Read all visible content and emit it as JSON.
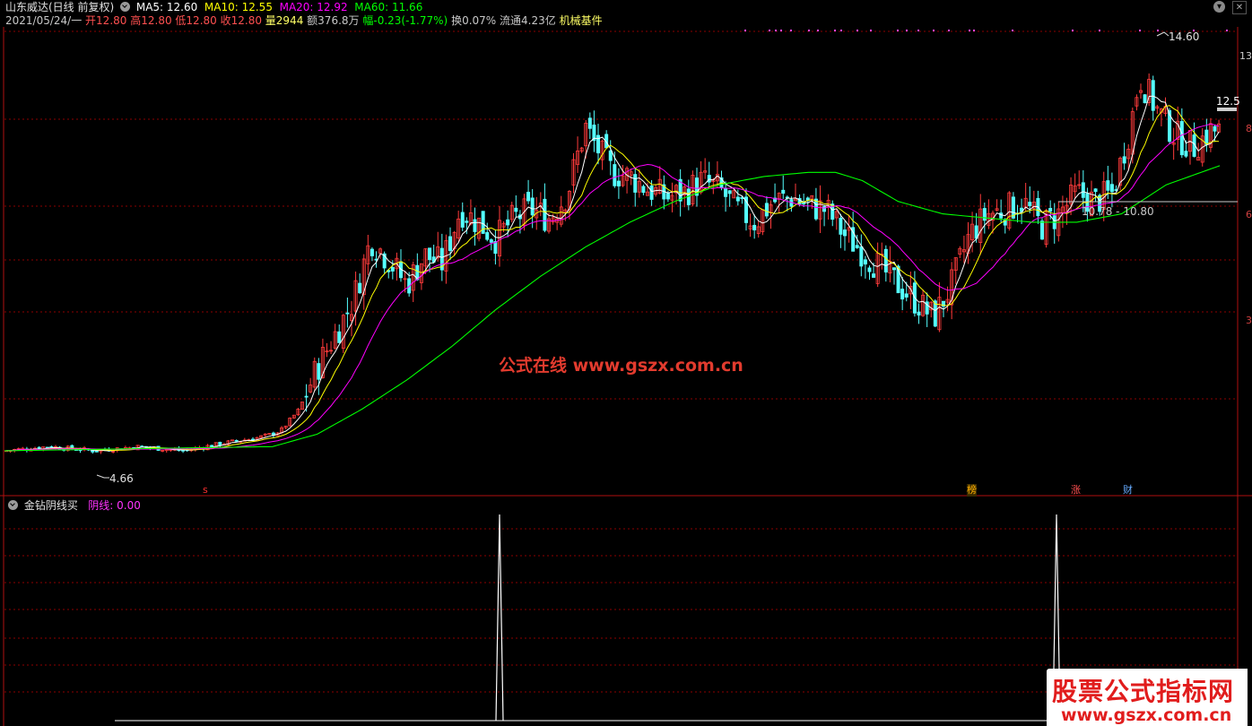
{
  "header": {
    "title": "山东威达(日线 前复权)",
    "ma5": "MA5: 12.60",
    "ma10": "MA10: 12.55",
    "ma20": "MA20: 12.92",
    "ma60": "MA60: 11.66",
    "date": "2021/05/24/一",
    "open": "开12.80",
    "high": "高12.80",
    "low": "低12.80",
    "close": "收12.80",
    "volume": "量2944",
    "amount": "额376.8万",
    "change": "幅-0.23(-1.77%)",
    "turnover": "换0.07%",
    "float": "流通4.23亿",
    "sector": "机械基件"
  },
  "annotations": {
    "high_label": "14.60",
    "low_label": "4.66",
    "price_box": "12.5",
    "range_label": "10.78 - 10.80",
    "axis_top": "13",
    "axis_1": "8",
    "axis_2": "6",
    "axis_3": "3",
    "tag_s": "s",
    "tag_bang": "榜",
    "tag_zhang": "涨",
    "tag_cai": "财"
  },
  "indicator": {
    "name": "金钻阴线买",
    "value_label": "阴线: 0.00"
  },
  "watermark": "公式在线  www.gszx.com.cn",
  "logo": {
    "line1": "股票公式指标网",
    "line2": "www.gszx.com.cn"
  },
  "colors": {
    "up": "#ff3b3b",
    "down": "#54ffff",
    "ma5": "#ffffff",
    "ma10": "#ffff00",
    "ma20": "#ff00ff",
    "ma60": "#00ff00",
    "grid": "#8b0000"
  },
  "chart_data": {
    "type": "candlestick",
    "price_trend": {
      "x": [
        0,
        50,
        100,
        150,
        200,
        250,
        280,
        300,
        310,
        330,
        350,
        370,
        390,
        410,
        430,
        450,
        470,
        490,
        510,
        530,
        550,
        570,
        590,
        610,
        630,
        650,
        660,
        680,
        700,
        720,
        740,
        760,
        780,
        800,
        820,
        840,
        860,
        880,
        900,
        920,
        940,
        960,
        980,
        1000,
        1020,
        1040,
        1060,
        1080,
        1100,
        1120,
        1140,
        1160,
        1180,
        1200,
        1220,
        1240,
        1260,
        1270,
        1290,
        1310,
        1330,
        1350
      ],
      "close": [
        4.8,
        4.9,
        4.8,
        4.9,
        4.8,
        5.0,
        5.1,
        5.2,
        5.3,
        5.8,
        6.8,
        7.6,
        8.4,
        9.9,
        9.4,
        8.8,
        9.5,
        9.3,
        10.6,
        10.3,
        9.9,
        10.4,
        10.6,
        10.4,
        11.0,
        12.6,
        12.2,
        11.5,
        11.4,
        11.1,
        10.9,
        11.0,
        11.3,
        11.1,
        10.6,
        10.3,
        10.8,
        10.9,
        10.7,
        10.6,
        10.0,
        9.6,
        9.2,
        8.8,
        8.4,
        8.0,
        8.8,
        10.0,
        10.5,
        10.6,
        10.8,
        10.2,
        10.5,
        11.0,
        10.8,
        11.0,
        12.6,
        13.8,
        13.0,
        12.4,
        12.1,
        12.5
      ]
    },
    "ma60": {
      "x": [
        0,
        300,
        350,
        400,
        450,
        500,
        550,
        600,
        650,
        700,
        750,
        800,
        850,
        900,
        930,
        960,
        1000,
        1050,
        1100,
        1150,
        1200,
        1250,
        1300,
        1360
      ],
      "values": [
        4.8,
        4.9,
        5.2,
        5.8,
        6.5,
        7.3,
        8.2,
        9.0,
        9.7,
        10.3,
        10.8,
        11.2,
        11.4,
        11.5,
        11.5,
        11.3,
        10.8,
        10.5,
        10.4,
        10.3,
        10.3,
        10.5,
        11.2,
        11.66
      ]
    },
    "indicator_spikes": [
      {
        "x": 557,
        "value": 1
      },
      {
        "x": 1178,
        "value": 1
      }
    ],
    "ylim": [
      4.0,
      15.0
    ]
  }
}
